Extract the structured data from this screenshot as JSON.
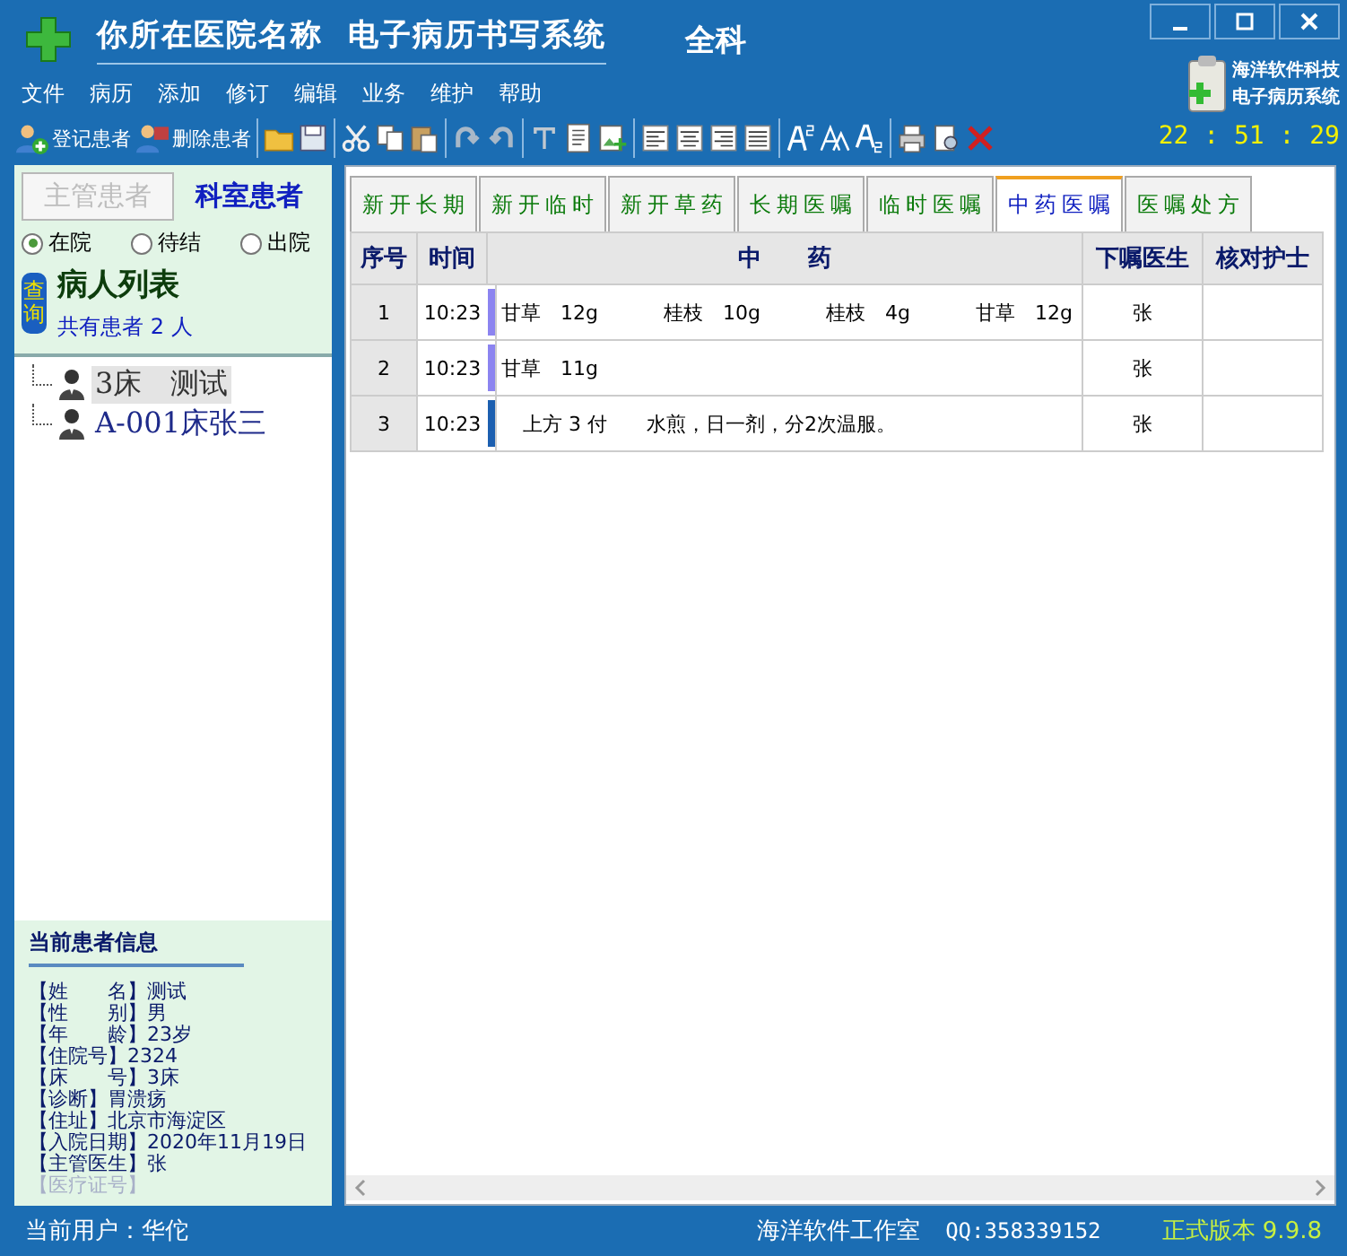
{
  "window": {
    "title": "你所在医院名称  电子病历书写系统",
    "department": "全科"
  },
  "menu": [
    "文件",
    "病历",
    "添加",
    "修订",
    "编辑",
    "业务",
    "维护",
    "帮助"
  ],
  "toolbar": {
    "buttons": [
      "登记患者",
      "删除患者"
    ]
  },
  "logo": {
    "lines": [
      "海洋软件科技",
      "电子病历系统"
    ]
  },
  "clock": "22 : 51 : 29",
  "patient_tabs": [
    {
      "label": "主管患者",
      "selected": false
    },
    {
      "label": "科室患者",
      "selected": true
    }
  ],
  "status_filter": [
    {
      "label": "在院",
      "selected": true
    },
    {
      "label": "待结",
      "selected": false
    },
    {
      "label": "出院",
      "selected": false
    }
  ],
  "query_button": "查询",
  "list_title": "病人列表",
  "patient_count": "共有患者 2 人",
  "patients": [
    {
      "label": "3床　测试",
      "selected": true
    },
    {
      "label": "A-001床张三",
      "selected": false
    }
  ],
  "info": {
    "title": "当前患者信息",
    "lines": [
      {
        "text": "【姓　　名】测试",
        "disabled": false
      },
      {
        "text": "【性　　别】男",
        "disabled": false
      },
      {
        "text": "【年　　龄】23岁",
        "disabled": false
      },
      {
        "text": "【住院号】2324",
        "disabled": false
      },
      {
        "text": "【床　　号】3床",
        "disabled": false
      },
      {
        "text": "【诊断】胃溃疡",
        "disabled": false
      },
      {
        "text": "【住址】北京市海淀区",
        "disabled": false
      },
      {
        "text": "【入院日期】2020年11月19日",
        "disabled": false
      },
      {
        "text": "【主管医生】张",
        "disabled": false
      },
      {
        "text": "【医疗证号】",
        "disabled": true
      }
    ]
  },
  "order_tabs": [
    {
      "label": "新开长期",
      "selected": false
    },
    {
      "label": "新开临时",
      "selected": false
    },
    {
      "label": "新开草药",
      "selected": false
    },
    {
      "label": "长期医嘱",
      "selected": false
    },
    {
      "label": "临时医嘱",
      "selected": false
    },
    {
      "label": "中药医嘱",
      "selected": true
    },
    {
      "label": "医嘱处方",
      "selected": false
    }
  ],
  "table": {
    "columns": [
      "序号",
      "时间",
      "中　　药",
      "下嘱医生",
      "核对护士"
    ],
    "rows": [
      {
        "no": "1",
        "time": "10:23",
        "color": "#8c84f0",
        "kind": "herbs",
        "items": [
          "甘草　12g",
          "桂枝　10g",
          "桂枝　4g",
          "甘草　12g"
        ],
        "doctor": "张"
      },
      {
        "no": "2",
        "time": "10:23",
        "color": "#8c84f0",
        "kind": "herbs",
        "items": [
          "甘草　11g"
        ],
        "doctor": "张"
      },
      {
        "no": "3",
        "time": "10:23",
        "color": "#1c5fb0",
        "kind": "note",
        "items": [
          "上方 3 付　　水煎，日一剂，分2次温服。"
        ],
        "doctor": "张"
      }
    ]
  },
  "status_bar": {
    "user": "当前用户：华佗",
    "studio": "海洋软件工作室",
    "qq": "QQ:358339152",
    "version": "正式版本 9.9.8"
  }
}
